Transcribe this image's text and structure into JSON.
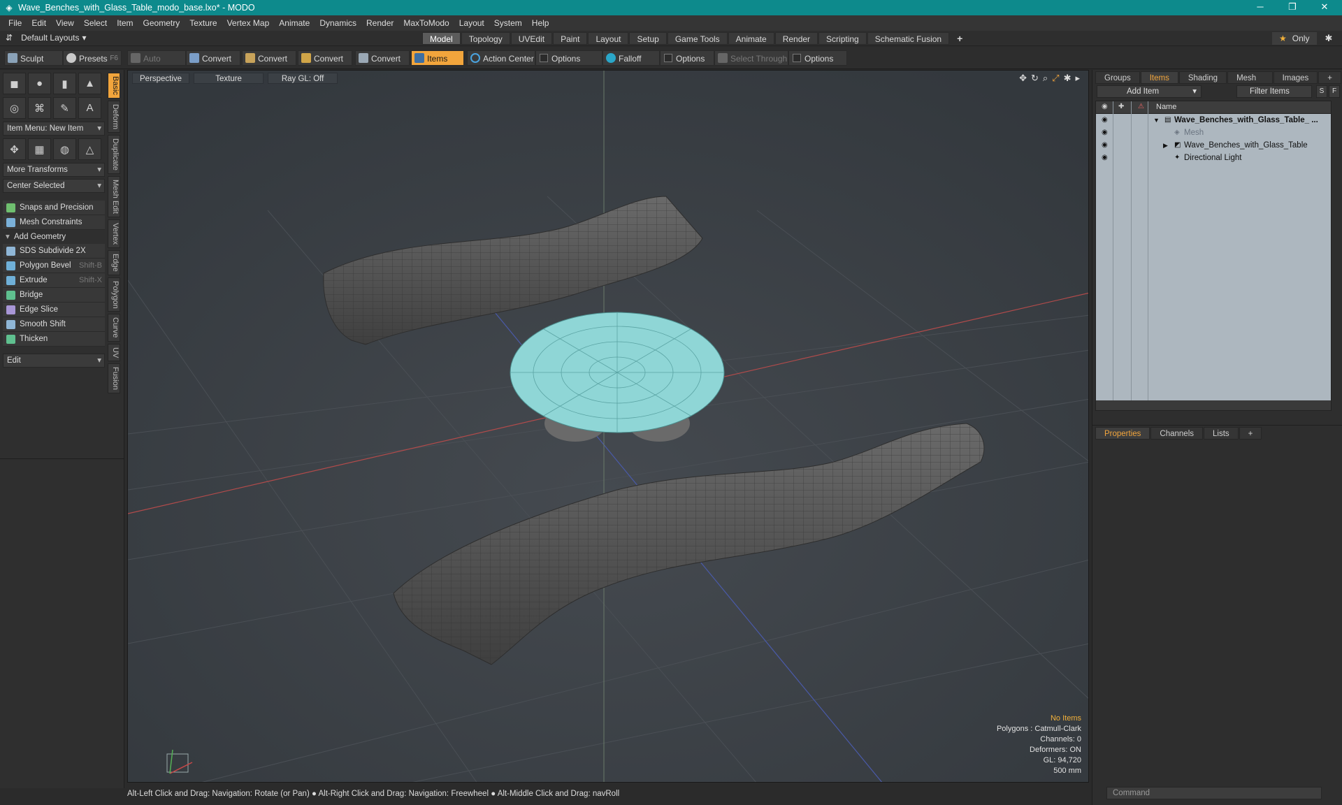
{
  "window": {
    "title": "Wave_Benches_with_Glass_Table_modo_base.lxo* - MODO",
    "min": "─",
    "max": "❐",
    "close": "✕"
  },
  "menu": [
    "File",
    "Edit",
    "View",
    "Select",
    "Item",
    "Geometry",
    "Texture",
    "Vertex Map",
    "Animate",
    "Dynamics",
    "Render",
    "MaxToModo",
    "Layout",
    "System",
    "Help"
  ],
  "layouts": {
    "label": "Default Layouts"
  },
  "tabs": [
    "Model",
    "Topology",
    "UVEdit",
    "Paint",
    "Layout",
    "Setup",
    "Game Tools",
    "Animate",
    "Render",
    "Scripting",
    "Schematic Fusion",
    "+"
  ],
  "active_tab": "Model",
  "only_label": "Only",
  "toolbar": {
    "sculpt": "Sculpt",
    "presets": "Presets",
    "presets_key": "F6",
    "auto_select": "Auto Select",
    "convert1": "Convert",
    "convert2": "Convert",
    "convert3": "Convert",
    "convert4": "Convert",
    "items": "Items",
    "action_center": "Action Center",
    "options1": "Options",
    "falloff": "Falloff",
    "options2": "Options",
    "select_through": "Select Through",
    "options3": "Options"
  },
  "left": {
    "item_menu": "Item Menu: New Item",
    "more_transforms": "More Transforms",
    "center_selected": "Center Selected",
    "snaps": "Snaps and Precision",
    "mesh_constraints": "Mesh Constraints",
    "add_geometry": "Add Geometry",
    "tools": [
      {
        "label": "SDS Subdivide 2X",
        "key": ""
      },
      {
        "label": "Polygon Bevel",
        "key": "Shift-B"
      },
      {
        "label": "Extrude",
        "key": "Shift-X"
      },
      {
        "label": "Bridge",
        "key": ""
      },
      {
        "label": "Edge Slice",
        "key": ""
      },
      {
        "label": "Smooth Shift",
        "key": ""
      },
      {
        "label": "Thicken",
        "key": ""
      }
    ],
    "edit": "Edit",
    "side_tabs": [
      "Basic",
      "Deform",
      "Duplicate",
      "Mesh Edit",
      "Vertex",
      "Edge",
      "Polygon",
      "Curve",
      "UV",
      "Fusion"
    ]
  },
  "viewport": {
    "perspective": "Perspective",
    "texture": "Texture",
    "raygl": "Ray GL: Off",
    "stats": {
      "no_items": "No Items",
      "polygons": "Polygons : Catmull-Clark",
      "channels": "Channels: 0",
      "deformers": "Deformers: ON",
      "gl": "GL: 94,720",
      "scale": "500 mm"
    }
  },
  "status": "Alt-Left Click and Drag: Navigation: Rotate (or Pan) ● Alt-Right Click and Drag: Navigation: Freewheel ● Alt-Middle Click and Drag: navRoll",
  "right": {
    "tabs": [
      "Groups",
      "Items",
      "Shading",
      "Mesh ...",
      "Images",
      "+"
    ],
    "active": "Items",
    "add_item": "Add Item",
    "filter": "Filter Items",
    "s": "S",
    "f": "F",
    "name_col": "Name",
    "rows": [
      {
        "label": "Wave_Benches_with_Glass_Table_ ...",
        "bold": true
      },
      {
        "label": "Mesh",
        "dim": true
      },
      {
        "label": "Wave_Benches_with_Glass_Table"
      },
      {
        "label": "Directional Light"
      }
    ],
    "bottom_tabs": [
      "Properties",
      "Channels",
      "Lists",
      "+"
    ],
    "command_placeholder": "Command"
  }
}
